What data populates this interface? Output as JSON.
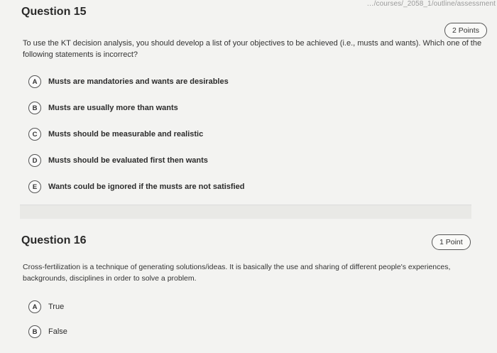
{
  "url_fragment": "…/courses/_2058_1/outline/assessment",
  "questions": [
    {
      "title": "Question 15",
      "points": "2 Points",
      "prompt": "To use the KT decision analysis, you should develop a list of your objectives to be achieved (i.e., musts and wants). Which one of the following statements is incorrect?",
      "options": [
        {
          "letter": "A",
          "text": "Musts are mandatories and wants are desirables"
        },
        {
          "letter": "B",
          "text": "Musts are usually more than wants"
        },
        {
          "letter": "C",
          "text": "Musts should be measurable and realistic"
        },
        {
          "letter": "D",
          "text": "Musts should be evaluated first then wants"
        },
        {
          "letter": "E",
          "text": "Wants could be ignored if the musts are not satisfied"
        }
      ]
    },
    {
      "title": "Question 16",
      "points": "1 Point",
      "prompt": "Cross-fertilization is a technique of generating solutions/ideas. It is basically the use and sharing of different people's experiences, backgrounds, disciplines in order to solve a problem.",
      "options": [
        {
          "letter": "A",
          "text": "True"
        },
        {
          "letter": "B",
          "text": "False"
        }
      ]
    }
  ]
}
